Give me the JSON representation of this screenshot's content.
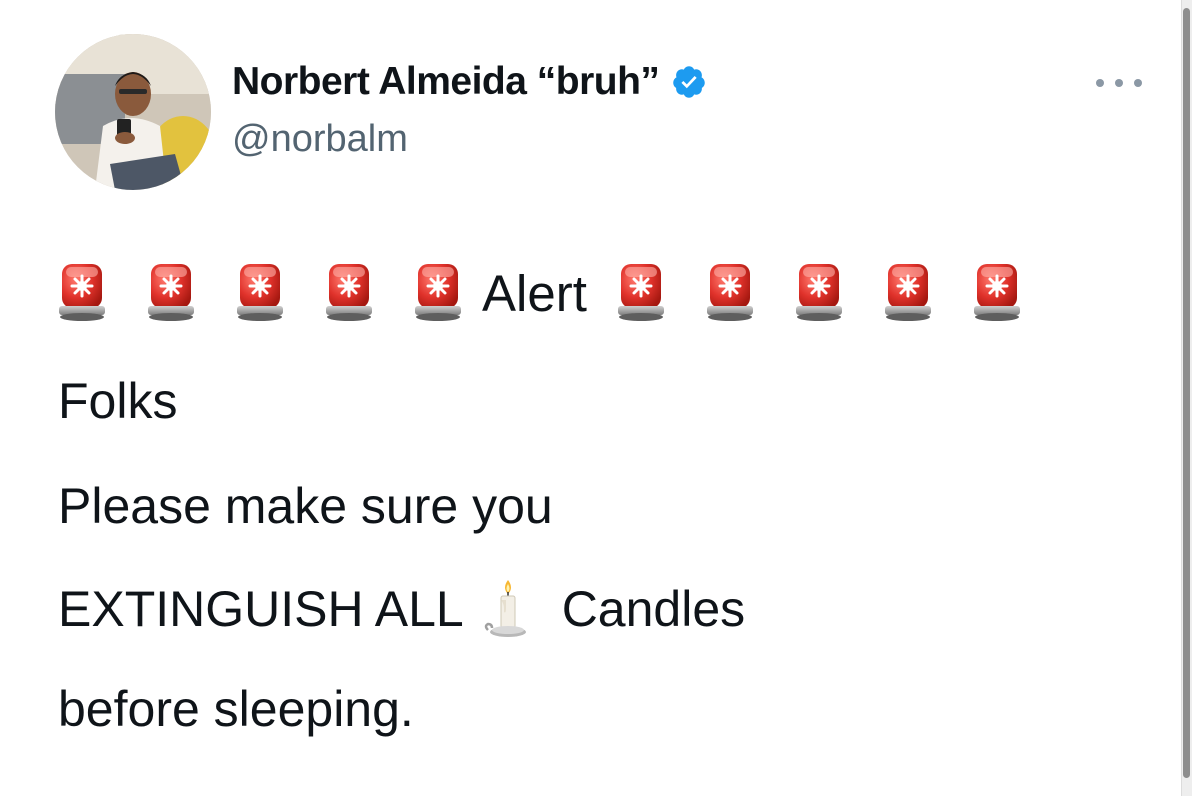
{
  "tweet": {
    "author": {
      "display_name": "Norbert Almeida “bruh”",
      "handle": "@norbalm",
      "verified": true,
      "avatar_icon": "profile-photo"
    },
    "menu_icon": "more-horizontal-icon",
    "body": {
      "alert_word": "Alert",
      "siren_icon": "police-car-light-emoji",
      "sirens_before": 5,
      "sirens_after": 5,
      "line_folks": "Folks",
      "line_please": "Please make sure you",
      "line_extinguish": "EXTINGUISH ALL",
      "candle_icon": "candle-emoji",
      "line_candles": "Candles",
      "line_before": "before sleeping."
    }
  },
  "colors": {
    "text": "#0f1419",
    "handle": "#536471",
    "verified_badge": "#1d9bf0",
    "siren_red": "#e0322b",
    "menu_dots": "#8b98a5"
  }
}
